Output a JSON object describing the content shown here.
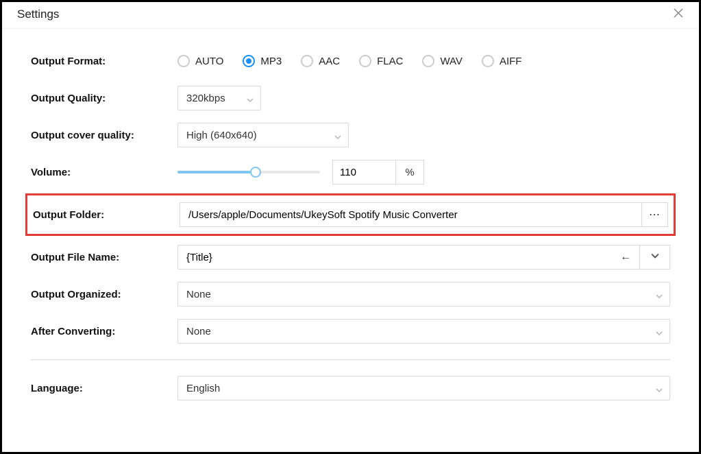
{
  "header": {
    "title": "Settings"
  },
  "labels": {
    "output_format": "Output Format:",
    "output_quality": "Output Quality:",
    "output_cover_quality": "Output cover quality:",
    "volume": "Volume:",
    "output_folder": "Output Folder:",
    "output_file_name": "Output File Name:",
    "output_organized": "Output Organized:",
    "after_converting": "After Converting:",
    "language": "Language:"
  },
  "format": {
    "options": [
      "AUTO",
      "MP3",
      "AAC",
      "FLAC",
      "WAV",
      "AIFF"
    ],
    "selected": "MP3"
  },
  "quality": {
    "value": "320kbps"
  },
  "cover_quality": {
    "value": "High (640x640)"
  },
  "volume": {
    "value": "110",
    "percent_of_200": 55,
    "unit": "%"
  },
  "output_folder": {
    "path": "/Users/apple/Documents/UkeySoft Spotify Music Converter"
  },
  "output_file_name": {
    "value": "{Title}"
  },
  "output_organized": {
    "value": "None"
  },
  "after_converting": {
    "value": "None"
  },
  "language": {
    "value": "English"
  },
  "icons": {
    "more": "⋯",
    "arrow_left": "←"
  }
}
